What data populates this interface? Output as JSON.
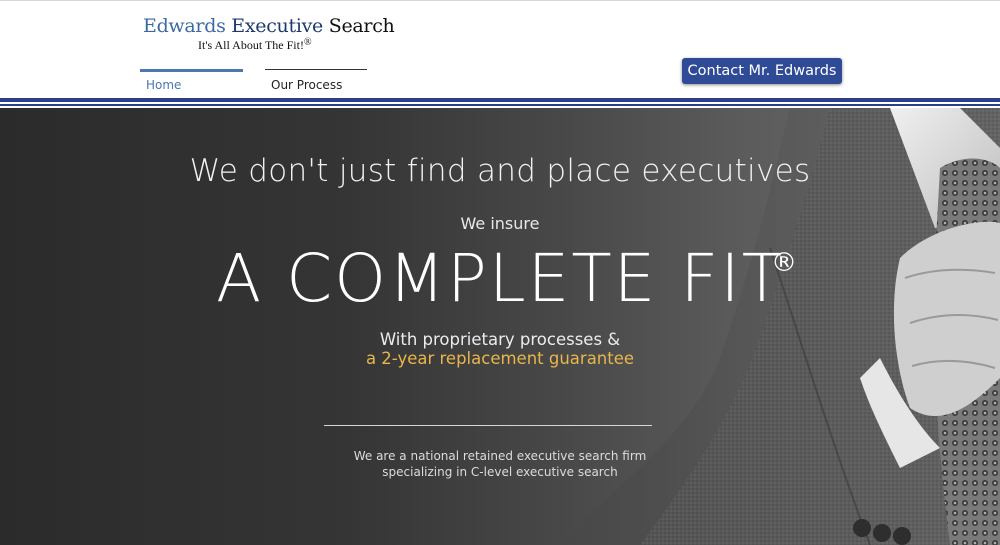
{
  "brand": {
    "word1": "Edwards",
    "word2": "Executive",
    "word3": "Search",
    "tagline": "It's All About The Fit!",
    "tagline_mark": "®",
    "colors": {
      "word1": "#3b69a5",
      "word2": "#1d3a6e",
      "word3": "#111111"
    }
  },
  "nav": {
    "items": [
      {
        "label": "Home",
        "active": true
      },
      {
        "label": "Our Process",
        "active": false
      }
    ],
    "active_color": "#4a78b0"
  },
  "header": {
    "contact_label": "Contact Mr. Edwards",
    "contact_color": "#2f4b95",
    "rule_color": "#2a3f88"
  },
  "hero": {
    "headline": "We don't just find and place executives",
    "sub": "We insure",
    "big": "A COMPLETE FIT",
    "big_mark": "®",
    "line_processes": "With proprietary processes &",
    "line_guarantee": "a 2-year replacement guarantee",
    "guarantee_color": "#e8b64a",
    "desc_line1": "We are a national retained executive search firm",
    "desc_line2": "specializing in C-level executive search"
  }
}
